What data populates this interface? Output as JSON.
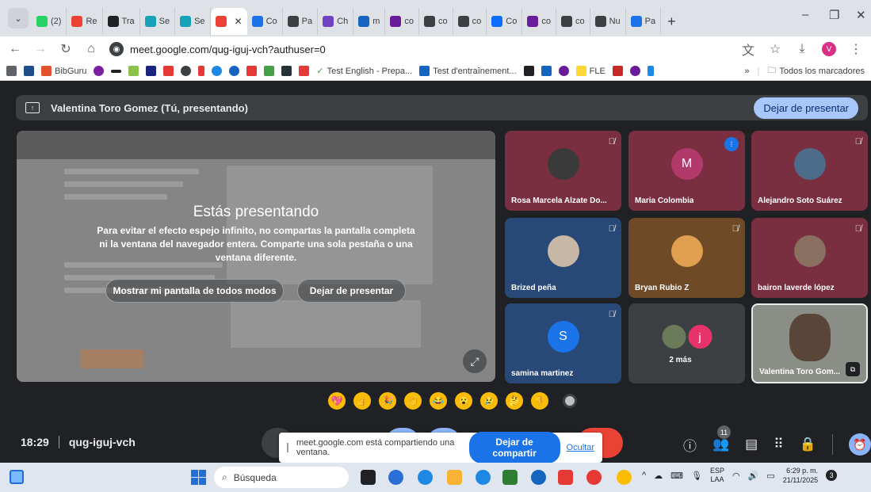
{
  "browser": {
    "tabs": [
      {
        "label": "(2)",
        "color": "#25d366"
      },
      {
        "label": "Re",
        "color": "#ea4335"
      },
      {
        "label": "Tra",
        "color": "#202124"
      },
      {
        "label": "Se",
        "color": "#17a2b8"
      },
      {
        "label": "Se",
        "color": "#17a2b8"
      },
      {
        "label": "",
        "color": "#ea4335",
        "active": true
      },
      {
        "label": "Co",
        "color": "#1a73e8"
      },
      {
        "label": "Pa",
        "color": "#3c4043"
      },
      {
        "label": "Ch",
        "color": "#6f42c1"
      },
      {
        "label": "m",
        "color": "#1565c0"
      },
      {
        "label": "co",
        "color": "#6a1b9a"
      },
      {
        "label": "co",
        "color": "#3c4043"
      },
      {
        "label": "co",
        "color": "#3c4043"
      },
      {
        "label": "Co",
        "color": "#0d6efd"
      },
      {
        "label": "co",
        "color": "#6a1b9a"
      },
      {
        "label": "co",
        "color": "#3c4043"
      },
      {
        "label": "Nu",
        "color": "#3c4043"
      },
      {
        "label": "Pa",
        "color": "#1a73e8"
      }
    ],
    "url": "meet.google.com/qug-iguj-vch?authuser=0",
    "profile_initial": "V",
    "bookmarks": {
      "bibguru": "BibGuru",
      "test_english": "Test English - Prepa...",
      "test_entrainement": "Test d'entraînement...",
      "fle": "FLE",
      "all_bookmarks": "Todos los marcadores",
      "more": "»"
    }
  },
  "meet": {
    "presenter_bar_title": "Valentina Toro Gomez (Tú, presentando)",
    "stop_presenting_top": "Dejar de presentar",
    "overlay": {
      "title": "Estás presentando",
      "text": "Para evitar el efecto espejo infinito, no compartas la pantalla completa ni la ventana del navegador entera. Comparte una sola pestaña o una ventana diferente.",
      "show_anyway": "Mostrar mi pantalla de todos modos",
      "stop_presenting": "Dejar de presentar"
    },
    "participants": [
      {
        "name": "Rosa Marcela Alzate Do...",
        "bg": "#7a2f40",
        "avatar_bg": "#3a3a3a",
        "initial": "",
        "muted": true
      },
      {
        "name": "Maria Colombia",
        "bg": "#7a2f40",
        "avatar_bg": "#b23a6b",
        "initial": "M",
        "muted": false,
        "talking": true
      },
      {
        "name": "Alejandro Soto Suárez",
        "bg": "#7a2f40",
        "avatar_bg": "#4d6c8a",
        "initial": "",
        "muted": true
      },
      {
        "name": "Brized peña",
        "bg": "#284978",
        "avatar_bg": "#c9b7a6",
        "initial": "",
        "muted": true
      },
      {
        "name": "Bryan Rubio Z",
        "bg": "#6e4a26",
        "avatar_bg": "#e0a050",
        "initial": "",
        "muted": true
      },
      {
        "name": "bairon laverde lópez",
        "bg": "#7a2f40",
        "avatar_bg": "#8a7060",
        "initial": "",
        "muted": true
      },
      {
        "name": "samina martinez",
        "bg": "#284978",
        "avatar_bg": "#1a73e8",
        "initial": "S",
        "muted": true
      },
      {
        "name": "2 más",
        "bg": "#3c4043",
        "avatar_bg": "#e8336a",
        "initial": "j",
        "muted": false
      },
      {
        "name": "Valentina Toro Gom...",
        "bg": "#8a8e86",
        "avatar_bg": "#5a4638",
        "initial": "",
        "muted": false
      }
    ],
    "reactions": [
      "💖",
      "👍",
      "🎉",
      "👏",
      "😂",
      "😮",
      "😢",
      "🤔",
      "👎"
    ],
    "time": "18:29",
    "meeting_code": "qug-iguj-vch",
    "share_bar": {
      "text": "meet.google.com está compartiendo una ventana.",
      "stop": "Dejar de compartir",
      "hide": "Ocultar"
    },
    "participants_count": "11"
  },
  "taskbar": {
    "search_placeholder": "Búsqueda",
    "lang_top": "ESP",
    "lang_bottom": "LAA",
    "time": "6:29 p. m.",
    "date": "21/11/2025",
    "notifications": "3"
  }
}
